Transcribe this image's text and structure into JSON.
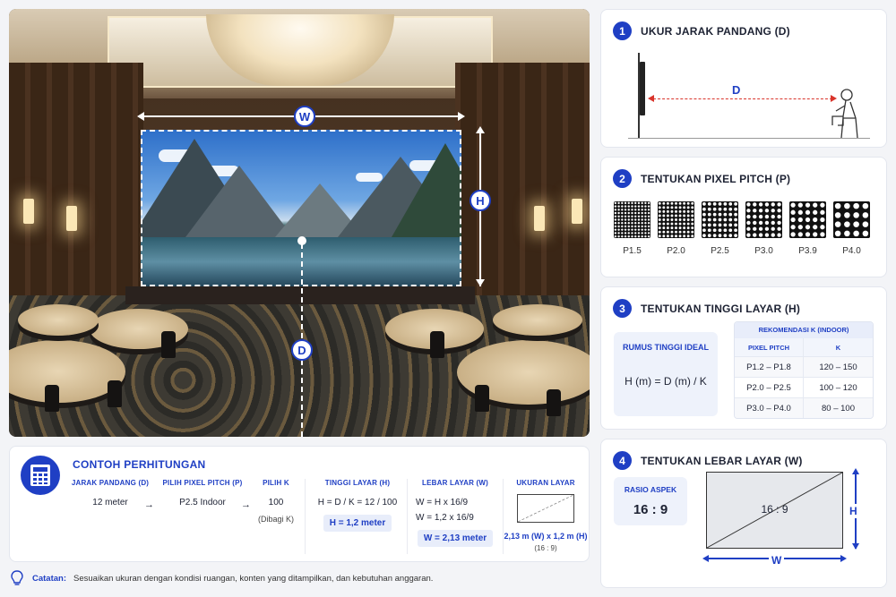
{
  "photo": {
    "label_w": "W",
    "label_h": "H",
    "label_d": "D"
  },
  "steps": [
    {
      "num": "1",
      "title": "UKUR JARAK PANDANG (D)",
      "diagram_label": "D"
    },
    {
      "num": "2",
      "title": "TENTUKAN PIXEL PITCH (P)",
      "pitches": [
        {
          "label": "P1.5",
          "grid": 11
        },
        {
          "label": "P2.0",
          "grid": 9
        },
        {
          "label": "P2.5",
          "grid": 7
        },
        {
          "label": "P3.0",
          "grid": 6
        },
        {
          "label": "P3.9",
          "grid": 5
        },
        {
          "label": "P4.0",
          "grid": 4
        }
      ]
    },
    {
      "num": "3",
      "title": "TENTUKAN TINGGI LAYAR (H)",
      "formula_title": "RUMUS TINGGI IDEAL",
      "formula": "H (m) = D (m) / K",
      "table_title": "REKOMENDASI K (INDOOR)",
      "table_headers": [
        "PIXEL PITCH",
        "K"
      ],
      "table_rows": [
        [
          "P1.2 – P1.8",
          "120 – 150"
        ],
        [
          "P2.0 – P2.5",
          "100 – 120"
        ],
        [
          "P3.0 – P4.0",
          "80 – 100"
        ]
      ]
    },
    {
      "num": "4",
      "title": "TENTUKAN LEBAR LAYAR (W)",
      "aspect_title": "RASIO ASPEK",
      "aspect_value": "16 : 9",
      "screen_label": "16 : 9",
      "dim_h": "H",
      "dim_w": "W"
    }
  ],
  "example": {
    "title": "CONTOH PERHITUNGAN",
    "columns": [
      {
        "head": "JARAK PANDANG (D)",
        "value": "12 meter"
      },
      {
        "head": "PILIH PIXEL PITCH (P)",
        "value": "P2.5 Indoor"
      },
      {
        "head": "PILIH K",
        "value": "100",
        "sub": "(Dibagi K)"
      },
      {
        "head": "TINGGI LAYAR (H)",
        "value": "H = D / K = 12 / 100",
        "highlight": "H = 1,2 meter"
      },
      {
        "head": "LEBAR LAYAR (W)",
        "value": "W = H x 16/9",
        "value2": "W = 1,2 x 16/9",
        "highlight": "W = 2,13 meter"
      },
      {
        "head": "UKURAN LAYAR",
        "result": "2,13 m (W) x 1,2 m (H)",
        "sub": "(16 : 9)"
      }
    ],
    "arrow": "→"
  },
  "note": {
    "label": "Catatan:",
    "text": "Sesuaikan ukuran dengan kondisi ruangan, konten yang ditampilkan, dan kebutuhan anggaran."
  },
  "colors": {
    "accent": "#1f3fc4",
    "red": "#d9342b"
  }
}
